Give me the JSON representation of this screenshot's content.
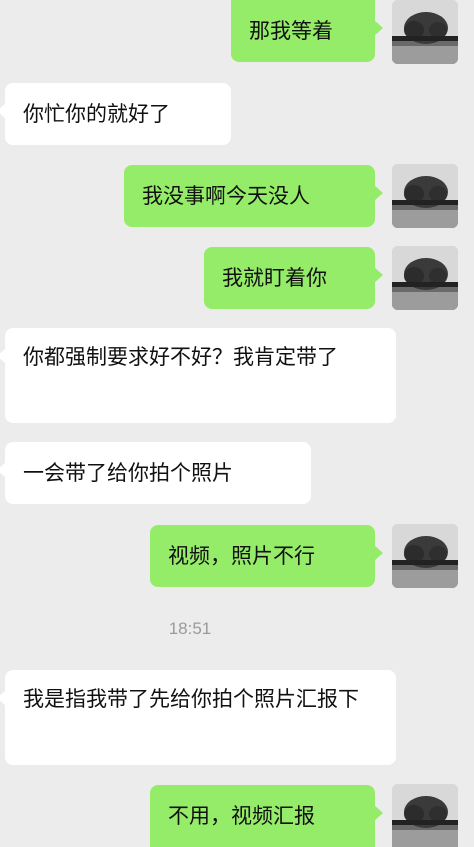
{
  "messages": [
    {
      "side": "out",
      "text": "那我等着"
    },
    {
      "side": "in",
      "text": "你忙你的就好了"
    },
    {
      "side": "out",
      "text": "我没事啊今天没人"
    },
    {
      "side": "out",
      "text": "我就盯着你"
    },
    {
      "side": "in",
      "text": "你都强制要求好不好？我肯定带了"
    },
    {
      "side": "in",
      "text": "一会带了给你拍个照片"
    },
    {
      "side": "out",
      "text": "视频，照片不行"
    },
    {
      "side": "in",
      "text": "我是指我带了先给你拍个照片汇报下"
    },
    {
      "side": "out",
      "text": "不用，视频汇报"
    }
  ],
  "timestamp": "18:51",
  "colors": {
    "background": "#ececec",
    "incoming_bubble": "#ffffff",
    "outgoing_bubble": "#95ec69"
  },
  "avatar_icon": "tree-landscape-photo-avatar"
}
